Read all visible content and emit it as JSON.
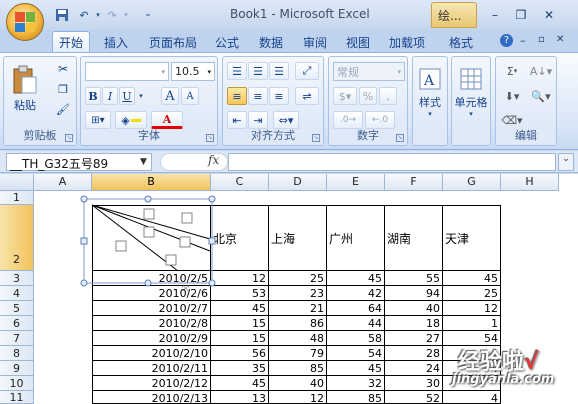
{
  "app": {
    "title": "Book1 - Microsoft Excel",
    "context_tab": "绘..."
  },
  "quick_access": {
    "undo_icon": "undo-icon",
    "redo_icon": "redo-icon",
    "save_icon": "save-icon"
  },
  "tabs": [
    "开始",
    "插入",
    "页面布局",
    "公式",
    "数据",
    "审阅",
    "视图",
    "加载项",
    "格式"
  ],
  "ribbon": {
    "clipboard": {
      "label": "剪贴板",
      "paste": "粘贴"
    },
    "font": {
      "label": "字体",
      "name": "",
      "size": "10.5",
      "bold": "B",
      "italic": "I",
      "underline": "U",
      "grow": "A",
      "shrink": "A",
      "color_a": "A"
    },
    "alignment": {
      "label": "对齐方式"
    },
    "number": {
      "label": "数字",
      "format": "常规",
      "percent": "%",
      "comma": ","
    },
    "styles": {
      "label": "样式"
    },
    "cells": {
      "label": "单元格"
    },
    "editing": {
      "label": "编辑",
      "sigma": "Σ"
    }
  },
  "formula_bar": {
    "name_box": "__TH_G32五号89",
    "fx": "fx",
    "value": ""
  },
  "columns": [
    "A",
    "B",
    "C",
    "D",
    "E",
    "F",
    "G",
    "H"
  ],
  "rows": [
    "1",
    "2",
    "3",
    "4",
    "5",
    "6",
    "7",
    "8",
    "9",
    "10",
    "11"
  ],
  "header_cities": [
    "北京",
    "上海",
    "广州",
    "湖南",
    "天津"
  ],
  "table": [
    {
      "date": "2010/2/5",
      "vals": [
        "12",
        "25",
        "45",
        "55",
        "45"
      ]
    },
    {
      "date": "2010/2/6",
      "vals": [
        "53",
        "23",
        "42",
        "94",
        "25"
      ]
    },
    {
      "date": "2010/2/7",
      "vals": [
        "45",
        "21",
        "64",
        "40",
        "12"
      ]
    },
    {
      "date": "2010/2/8",
      "vals": [
        "15",
        "86",
        "44",
        "18",
        "1"
      ]
    },
    {
      "date": "2010/2/9",
      "vals": [
        "15",
        "48",
        "58",
        "27",
        "54"
      ]
    },
    {
      "date": "2010/2/10",
      "vals": [
        "56",
        "79",
        "54",
        "28",
        "4"
      ]
    },
    {
      "date": "2010/2/11",
      "vals": [
        "35",
        "85",
        "45",
        "24",
        "4"
      ]
    },
    {
      "date": "2010/2/12",
      "vals": [
        "45",
        "40",
        "32",
        "30",
        ""
      ]
    },
    {
      "date": "2010/2/13",
      "vals": [
        "13",
        "12",
        "85",
        "52",
        "4"
      ]
    }
  ],
  "watermark": {
    "line1": "经验啦",
    "check": "√",
    "line2": "jingyanla.com"
  }
}
